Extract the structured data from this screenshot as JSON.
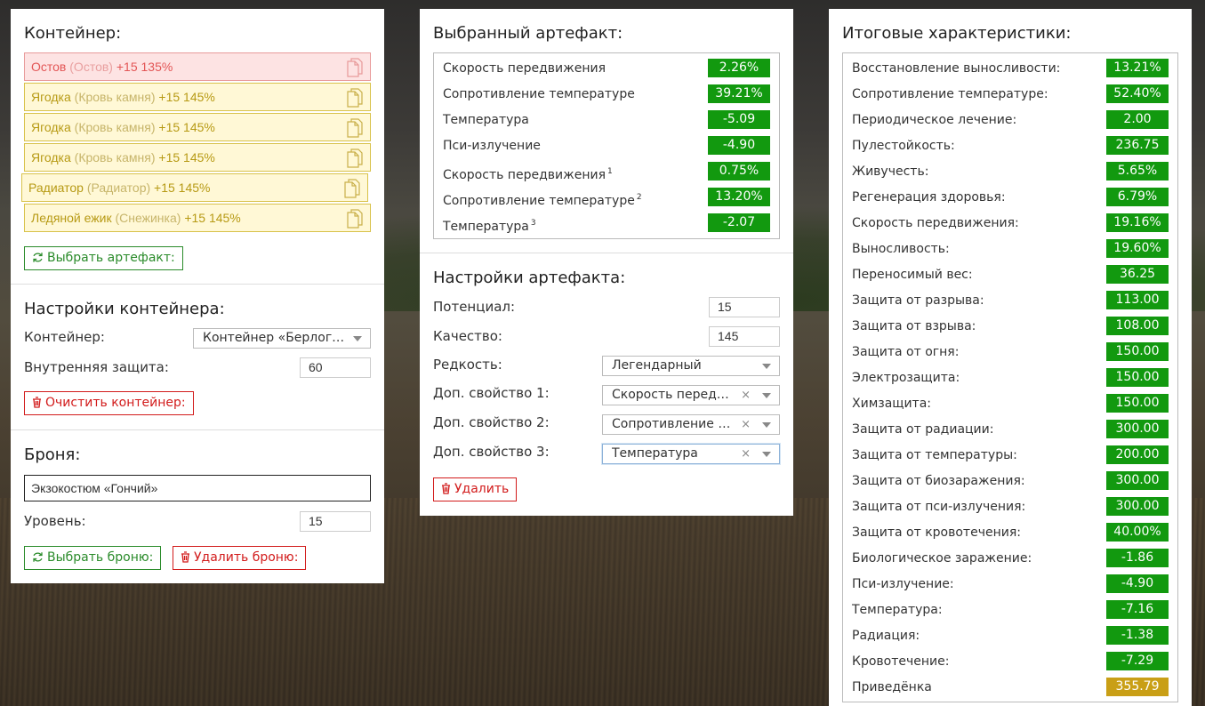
{
  "container_panel": {
    "title": "Контейнер:",
    "items": [
      {
        "name": "Остов",
        "sub": "(Остов)",
        "bonus": "+15 135%",
        "style": "red"
      },
      {
        "name": "Ягодка",
        "sub": "(Кровь камня)",
        "bonus": "+15 145%",
        "style": "yellow"
      },
      {
        "name": "Ягодка",
        "sub": "(Кровь камня)",
        "bonus": "+15 145%",
        "style": "yellow"
      },
      {
        "name": "Ягодка",
        "sub": "(Кровь камня)",
        "bonus": "+15 145%",
        "style": "yellow"
      },
      {
        "name": "Радиатор",
        "sub": "(Радиатор)",
        "bonus": "+15 145%",
        "style": "yellow"
      },
      {
        "name": "Ледяной ежик",
        "sub": "(Снежинка)",
        "bonus": "+15 145%",
        "style": "yellow"
      }
    ],
    "select_artifact_button": "Выбрать артефакт:"
  },
  "container_settings": {
    "title": "Настройки контейнера:",
    "container_label": "Контейнер:",
    "container_value": "Контейнер «Берлога…",
    "inner_protection_label": "Внутренняя защита:",
    "inner_protection_value": "60",
    "clear_button": "Очистить контейнер:"
  },
  "armor": {
    "title": "Броня:",
    "armor_value": "Экзокостюм «Гончий»",
    "level_label": "Уровень:",
    "level_value": "15",
    "select_button": "Выбрать броню:",
    "delete_button": "Удалить броню:"
  },
  "selected_artifact": {
    "title": "Выбранный артефакт:",
    "stats": [
      {
        "label": "Скорость передвижения",
        "sup": "",
        "value": "2.26%"
      },
      {
        "label": "Сопротивление температуре",
        "sup": "",
        "value": "39.21%"
      },
      {
        "label": "Температура",
        "sup": "",
        "value": "-5.09"
      },
      {
        "label": "Пси-излучение",
        "sup": "",
        "value": "-4.90"
      },
      {
        "label": "Скорость передвижения",
        "sup": "1",
        "value": "0.75%"
      },
      {
        "label": "Сопротивление температуре",
        "sup": "2",
        "value": "13.20%"
      },
      {
        "label": "Температура",
        "sup": "3",
        "value": "-2.07"
      }
    ]
  },
  "artifact_settings": {
    "title": "Настройки артефакта:",
    "potential_label": "Потенциал:",
    "potential_value": "15",
    "quality_label": "Качество:",
    "quality_value": "145",
    "rarity_label": "Редкость:",
    "rarity_value": "Легендарный",
    "prop1_label": "Доп. свойство 1:",
    "prop1_value": "Скорость передвижения",
    "prop2_label": "Доп. свойство 2:",
    "prop2_value": "Сопротивление температуре",
    "prop3_label": "Доп. свойство 3:",
    "prop3_value": "Температура",
    "clear_glyph": "×",
    "delete_button": "Удалить"
  },
  "totals": {
    "title": "Итоговые характеристики:",
    "stats": [
      {
        "label": "Восстановление выносливости:",
        "value": "13.21%",
        "color": "green"
      },
      {
        "label": "Сопротивление температуре:",
        "value": "52.40%",
        "color": "green"
      },
      {
        "label": "Периодическое лечение:",
        "value": "2.00",
        "color": "green"
      },
      {
        "label": "Пулестойкость:",
        "value": "236.75",
        "color": "green"
      },
      {
        "label": "Живучесть:",
        "value": "5.65%",
        "color": "green"
      },
      {
        "label": "Регенерация здоровья:",
        "value": "6.79%",
        "color": "green"
      },
      {
        "label": "Скорость передвижения:",
        "value": "19.16%",
        "color": "green"
      },
      {
        "label": "Выносливость:",
        "value": "19.60%",
        "color": "green"
      },
      {
        "label": "Переносимый вес:",
        "value": "36.25",
        "color": "green"
      },
      {
        "label": "Защита от разрыва:",
        "value": "113.00",
        "color": "green"
      },
      {
        "label": "Защита от взрыва:",
        "value": "108.00",
        "color": "green"
      },
      {
        "label": "Защита от огня:",
        "value": "150.00",
        "color": "green"
      },
      {
        "label": "Электрозащита:",
        "value": "150.00",
        "color": "green"
      },
      {
        "label": "Химзащита:",
        "value": "150.00",
        "color": "green"
      },
      {
        "label": "Защита от радиации:",
        "value": "300.00",
        "color": "green"
      },
      {
        "label": "Защита от температуры:",
        "value": "200.00",
        "color": "green"
      },
      {
        "label": "Защита от биозаражения:",
        "value": "300.00",
        "color": "green"
      },
      {
        "label": "Защита от пси-излучения:",
        "value": "300.00",
        "color": "green"
      },
      {
        "label": "Защита от кровотечения:",
        "value": "40.00%",
        "color": "green"
      },
      {
        "label": "Биологическое заражение:",
        "value": "-1.86",
        "color": "green"
      },
      {
        "label": "Пси-излучение:",
        "value": "-4.90",
        "color": "green"
      },
      {
        "label": "Температура:",
        "value": "-7.16",
        "color": "green"
      },
      {
        "label": "Радиация:",
        "value": "-1.38",
        "color": "green"
      },
      {
        "label": "Кровотечение:",
        "value": "-7.29",
        "color": "green"
      },
      {
        "label": "Приведёнка",
        "value": "355.79",
        "color": "gold"
      }
    ]
  },
  "colors": {
    "positive": "#12990f",
    "highlight": "#c99f16",
    "danger": "#d21b1b",
    "success": "#2a8b2a"
  }
}
